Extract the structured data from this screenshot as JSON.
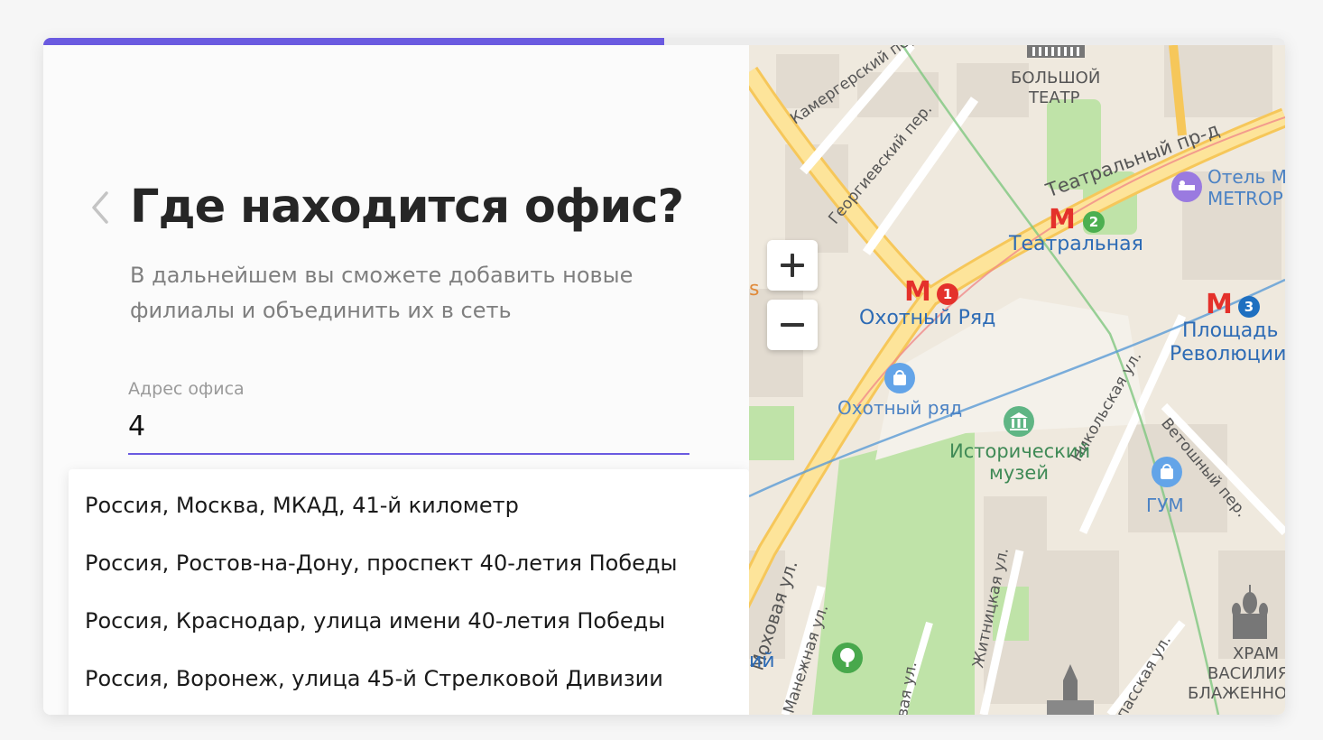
{
  "progress": {
    "fraction": 0.5
  },
  "form": {
    "title": "Где находится офис?",
    "subtitle": "В дальнейшем вы сможете добавить новые филиалы и объединить их в сеть",
    "address_label": "Адрес офиса",
    "address_value": "4"
  },
  "suggestions": [
    "Россия, Москва, МКАД, 41-й километр",
    "Россия, Ростов-на-Дону, проспект 40-летия Победы",
    "Россия, Краснодар, улица имени 40-летия Победы",
    "Россия, Воронеж, улица 45-й Стрелковой Дивизии"
  ],
  "map": {
    "zoom_in": "+",
    "zoom_out": "−",
    "streets": {
      "kamergersky": "Камергерский пер.",
      "georgievsky": "Георгиевский пер.",
      "teatralny": "Театральный пр-д",
      "nikolskaya": "Никольская ул.",
      "vetoshny": "Ветошный пер.",
      "mokhovaya": "Моховая ул.",
      "manezhnaya": "Манежная ул.",
      "zhitnitskaya": "Житницкая ул.",
      "spasskaya": "Спасская ул.",
      "edge_novaya": "овая ул.",
      "edge_s": "s",
      "edge_iy": "ий"
    },
    "metro": {
      "okhotny": {
        "name": "Охотный Ряд",
        "letter": "M",
        "line": "1"
      },
      "teatralnaya": {
        "name": "Театральная",
        "letter": "M",
        "line": "2"
      },
      "ploshchad": {
        "name_line1": "Площадь",
        "name_line2": "Революции",
        "letter": "M",
        "line": "3"
      }
    },
    "poi": {
      "bolshoi_1": "БОЛЬШОЙ",
      "bolshoi_2": "ТЕАТР",
      "hotel_1": "Отель М",
      "hotel_2": "METROP",
      "okhotny_mall": "Охотный ряд",
      "museum_1": "Исторический",
      "museum_2": "музей",
      "gum": "ГУМ",
      "cathedral_1": "ХРАМ",
      "cathedral_2": "ВАСИЛИЯ",
      "cathedral_3": "БЛАЖЕННО"
    },
    "colors": {
      "line1": "#e4312b",
      "line2": "#4caf50",
      "line3": "#1e6fc0",
      "accent": "#6a5ae0"
    }
  }
}
